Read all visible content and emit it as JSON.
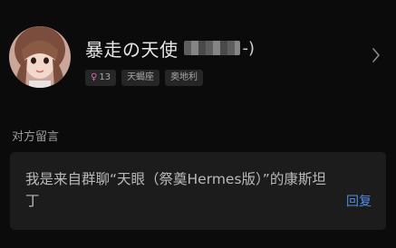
{
  "profile": {
    "name": "暴走の天使",
    "name_tail": "-)",
    "tags": [
      {
        "icon": "female-icon",
        "label": "13"
      },
      {
        "icon": "",
        "label": "天蝎座"
      },
      {
        "icon": "",
        "label": "奥地利"
      }
    ]
  },
  "section": {
    "title": "对方留言"
  },
  "message": {
    "text": "我是来自群聊“天眼（祭奠Hermes版）”的康斯坦丁",
    "reply_label": "回复"
  },
  "colors": {
    "background": "#0b0b0b",
    "card": "#1c1c1c",
    "accent": "#4f8fe0",
    "gender": "#d96aa6"
  }
}
